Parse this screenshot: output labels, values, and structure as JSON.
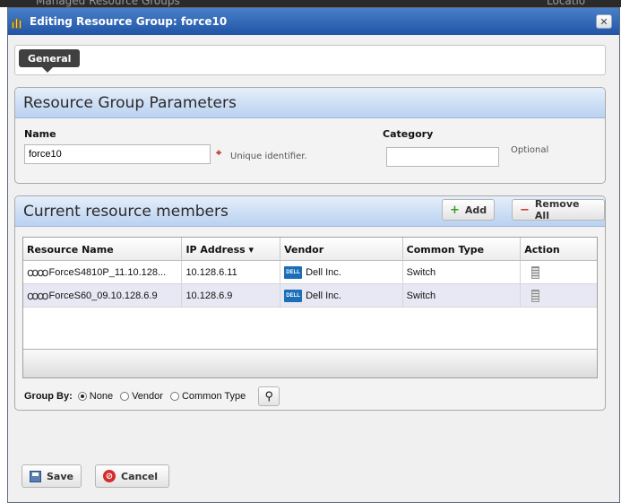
{
  "background_window": {
    "left_text": "Managed Resource Groups",
    "right_text": "Locatio"
  },
  "dialog": {
    "title": "Editing Resource Group: force10"
  },
  "tabs": [
    {
      "label": "General",
      "selected": true
    }
  ],
  "parameters": {
    "header": "Resource Group Parameters",
    "name_label": "Name",
    "name_value": "force10",
    "name_hint": "Unique identifier.",
    "category_label": "Category",
    "category_value": "",
    "category_hint": "Optional"
  },
  "members": {
    "header": "Current resource members",
    "add_label": "Add",
    "remove_all_label": "Remove All",
    "columns": [
      "Resource Name",
      "IP Address ▾",
      "Vendor",
      "Common Type",
      "Action"
    ],
    "rows": [
      {
        "name": "ForceS4810P_11.10.128...",
        "ip": "10.128.6.11",
        "vendor": "Dell Inc.",
        "type": "Switch"
      },
      {
        "name": "ForceS60_09.10.128.6.9",
        "ip": "10.128.6.9",
        "vendor": "Dell Inc.",
        "type": "Switch"
      }
    ],
    "vendor_logo_text": "DELL"
  },
  "group_by": {
    "label": "Group By:",
    "options": [
      "None",
      "Vendor",
      "Common Type"
    ],
    "selected": "None"
  },
  "footer": {
    "save_label": "Save",
    "cancel_label": "Cancel"
  },
  "colors": {
    "titlebar": "#1f55a5",
    "panel_header": "#b9d1f0",
    "selected_row": "#e8e8f5"
  }
}
